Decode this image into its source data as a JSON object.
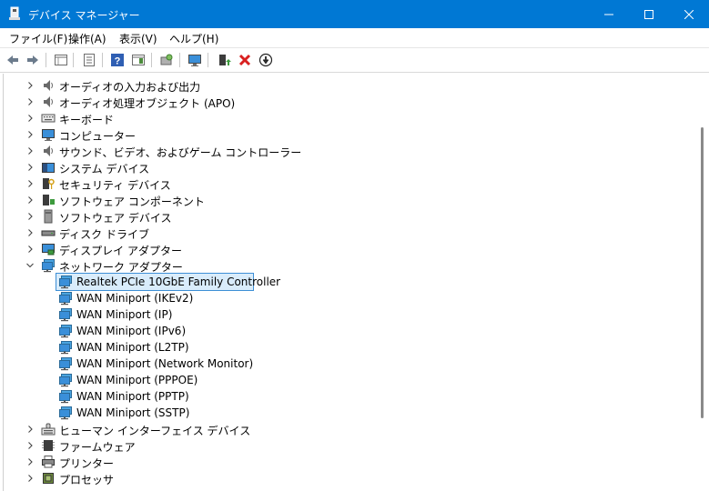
{
  "window": {
    "title": "デバイス マネージャー",
    "accent": "#0078d4"
  },
  "menu": [
    {
      "label": "ファイル(F)"
    },
    {
      "label": "操作(A)"
    },
    {
      "label": "表示(V)"
    },
    {
      "label": "ヘルプ(H)"
    }
  ],
  "toolbar": {
    "icons": [
      "back-icon",
      "forward-icon",
      "tree-view-icon",
      "properties-icon",
      "help-icon",
      "action-pane-icon",
      "scan-hardware-icon",
      "monitor-icon",
      "update-driver-icon",
      "uninstall-device-icon",
      "disable-device-icon"
    ]
  },
  "tree": {
    "categories_before": [
      {
        "label": "オーディオの入力および出力",
        "icon": "speaker-icon"
      },
      {
        "label": "オーディオ処理オブジェクト (APO)",
        "icon": "speaker-icon"
      },
      {
        "label": "キーボード",
        "icon": "keyboard-icon"
      },
      {
        "label": "コンピューター",
        "icon": "computer-icon"
      },
      {
        "label": "サウンド、ビデオ、およびゲーム コントローラー",
        "icon": "speaker-icon"
      },
      {
        "label": "システム デバイス",
        "icon": "system-device-icon"
      },
      {
        "label": "セキュリティ デバイス",
        "icon": "security-device-icon"
      },
      {
        "label": "ソフトウェア コンポーネント",
        "icon": "software-component-icon"
      },
      {
        "label": "ソフトウェア デバイス",
        "icon": "software-device-icon"
      },
      {
        "label": "ディスク ドライブ",
        "icon": "disk-drive-icon"
      },
      {
        "label": "ディスプレイ アダプター",
        "icon": "display-adapter-icon"
      }
    ],
    "expanded": {
      "label": "ネットワーク アダプター",
      "icon": "network-adapter-icon",
      "children": [
        {
          "label": "Realtek PCIe 10GbE Family Controller",
          "selected": true
        },
        {
          "label": "WAN Miniport (IKEv2)"
        },
        {
          "label": "WAN Miniport (IP)"
        },
        {
          "label": "WAN Miniport (IPv6)"
        },
        {
          "label": "WAN Miniport (L2TP)"
        },
        {
          "label": "WAN Miniport (Network Monitor)"
        },
        {
          "label": "WAN Miniport (PPPOE)"
        },
        {
          "label": "WAN Miniport (PPTP)"
        },
        {
          "label": "WAN Miniport (SSTP)"
        }
      ]
    },
    "categories_after": [
      {
        "label": "ヒューマン インターフェイス デバイス",
        "icon": "hid-icon"
      },
      {
        "label": "ファームウェア",
        "icon": "firmware-icon"
      },
      {
        "label": "プリンター",
        "icon": "printer-icon"
      },
      {
        "label": "プロセッサ",
        "icon": "processor-icon"
      }
    ]
  }
}
